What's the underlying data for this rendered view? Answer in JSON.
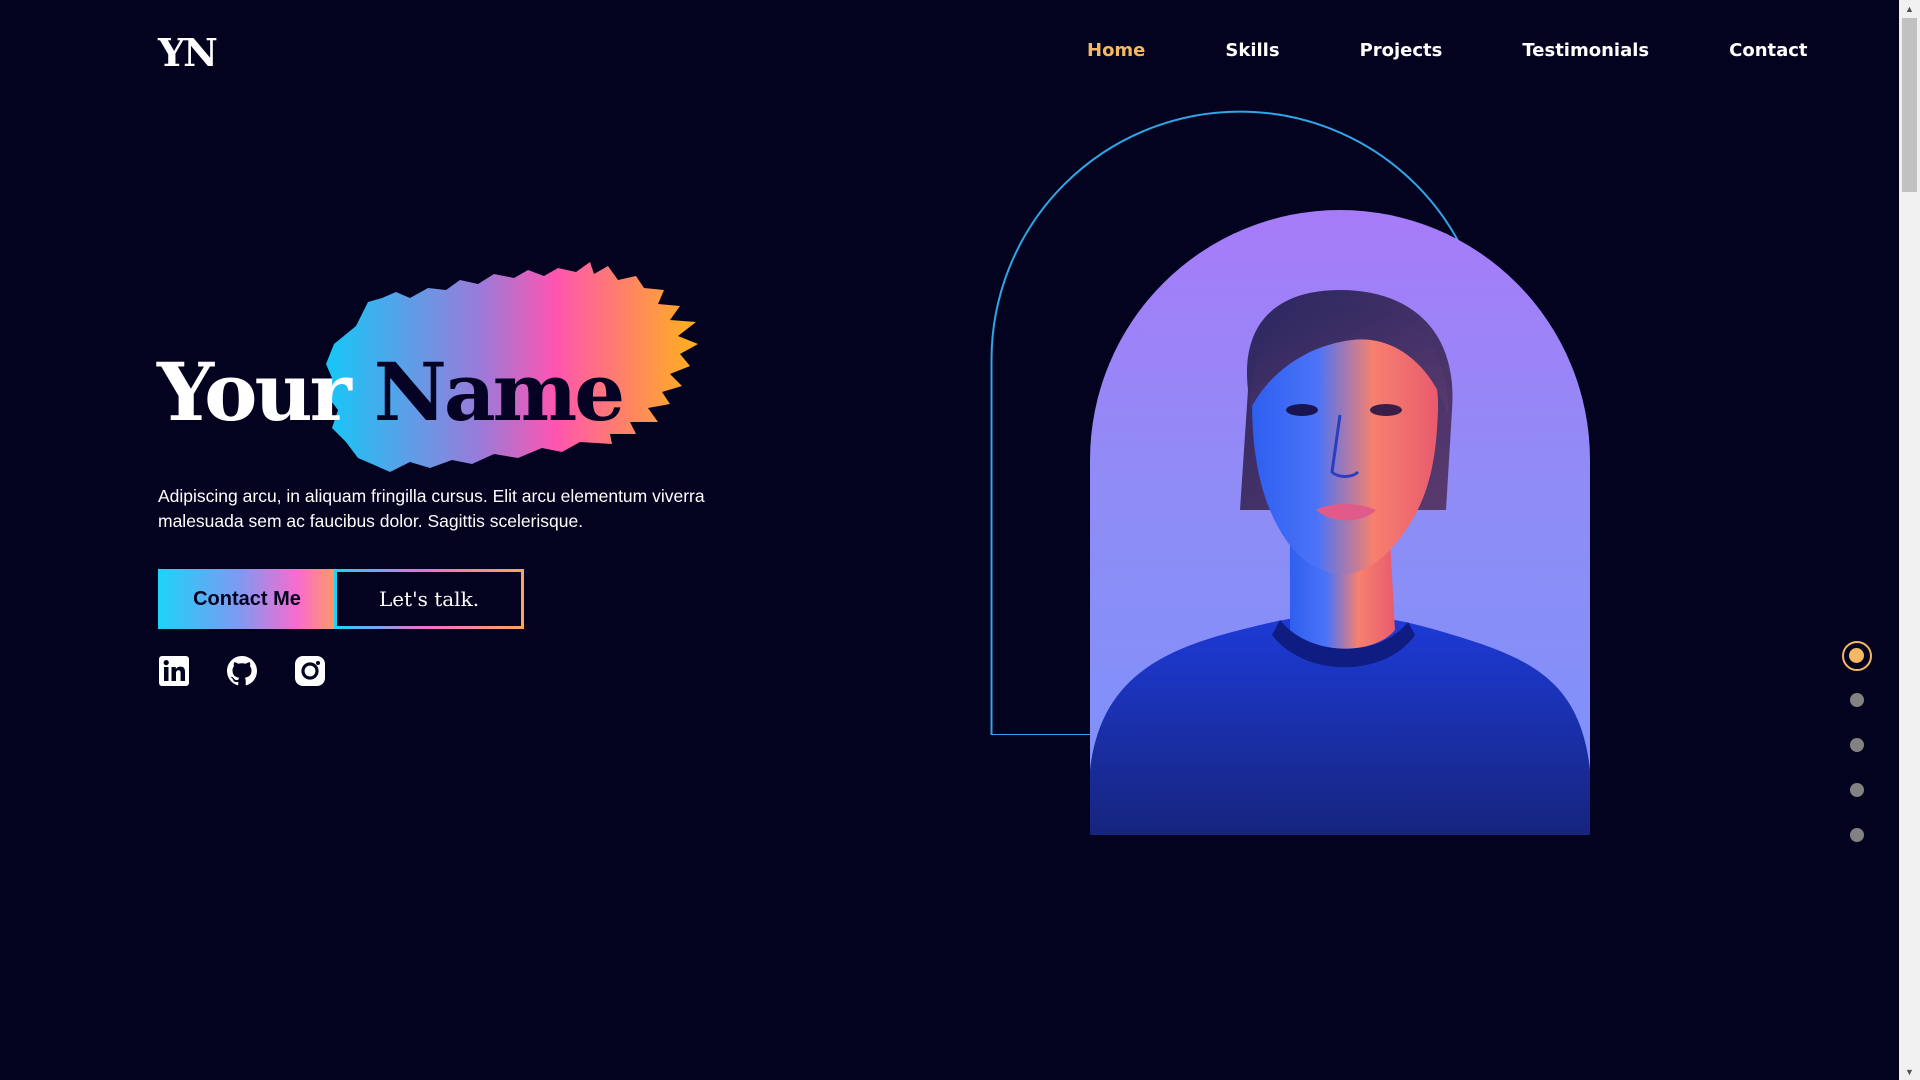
{
  "header": {
    "logo": "YN",
    "nav": [
      {
        "label": "Home",
        "active": true
      },
      {
        "label": "Skills",
        "active": false
      },
      {
        "label": "Projects",
        "active": false
      },
      {
        "label": "Testimonials",
        "active": false
      },
      {
        "label": "Contact",
        "active": false
      }
    ]
  },
  "hero": {
    "title_first": "Your",
    "title_second": "Name",
    "description": "Adipiscing arcu, in aliquam fringilla cursus. Elit arcu elementum viverra malesuada sem ac faucibus dolor. Sagittis scelerisque.",
    "primary_button": "Contact Me",
    "secondary_button": "Let's talk.",
    "socials": [
      "linkedin-icon",
      "github-icon",
      "instagram-icon"
    ]
  },
  "section_dots": {
    "count": 5,
    "active_index": 0
  },
  "colors": {
    "background": "#03021f",
    "accent": "#f5b964",
    "gradient": [
      "#1dd3f8",
      "#f86bd0",
      "#ffa35c"
    ],
    "arch_outline": "#2fa6e6"
  }
}
